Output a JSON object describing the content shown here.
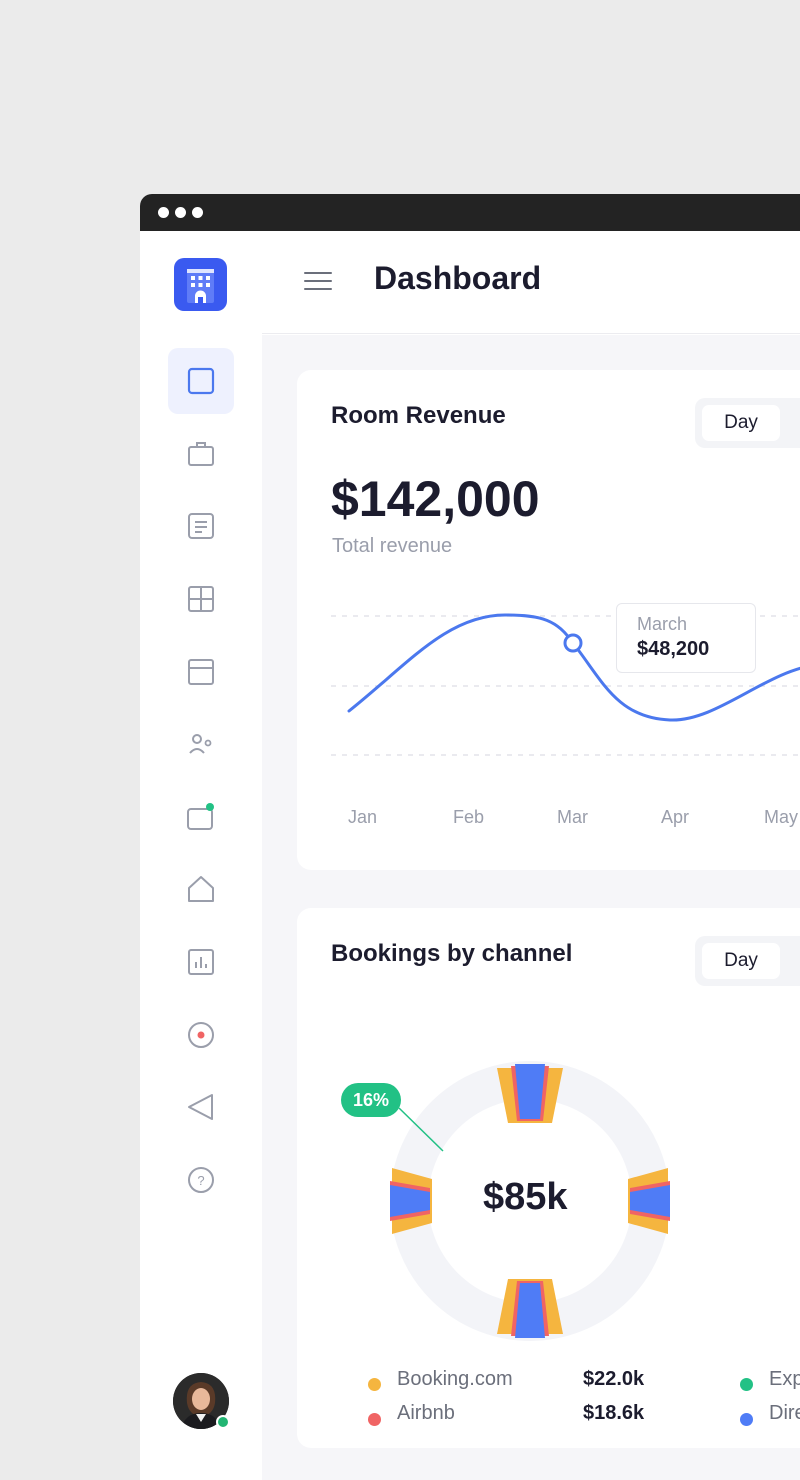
{
  "header": {
    "title": "Dashboard"
  },
  "sidebar": {
    "items": [
      {
        "icon": "square-icon",
        "active": true
      },
      {
        "icon": "briefcase-icon"
      },
      {
        "icon": "document-icon"
      },
      {
        "icon": "grid-icon"
      },
      {
        "icon": "layout-icon"
      },
      {
        "icon": "users-icon"
      },
      {
        "icon": "notification-icon"
      },
      {
        "icon": "home-icon"
      },
      {
        "icon": "chart-icon"
      },
      {
        "icon": "record-icon"
      },
      {
        "icon": "send-icon"
      },
      {
        "icon": "help-icon",
        "glyph": "?"
      }
    ]
  },
  "revenue": {
    "title": "Room Revenue",
    "period_button": "Day",
    "total": "$142,000",
    "total_label": "Total revenue",
    "tooltip": {
      "month": "March",
      "value": "$48,200"
    },
    "months": [
      "Jan",
      "Feb",
      "Mar",
      "Apr",
      "May"
    ]
  },
  "bookings": {
    "title": "Bookings by channel",
    "period_button": "Day",
    "center_value": "$85k",
    "badge": "16%",
    "legend": [
      {
        "label": "Booking.com",
        "value": "$22.0k",
        "color": "#f5b53f"
      },
      {
        "label": "Airbnb",
        "value": "$18.6k",
        "color": "#f06464"
      },
      {
        "label": "Exp",
        "color": "#22c185"
      },
      {
        "label": "Dire",
        "color": "#4f7cf6"
      }
    ]
  },
  "colors": {
    "accent": "#3a5af0",
    "line": "#4b78ee",
    "online": "#22b573"
  }
}
